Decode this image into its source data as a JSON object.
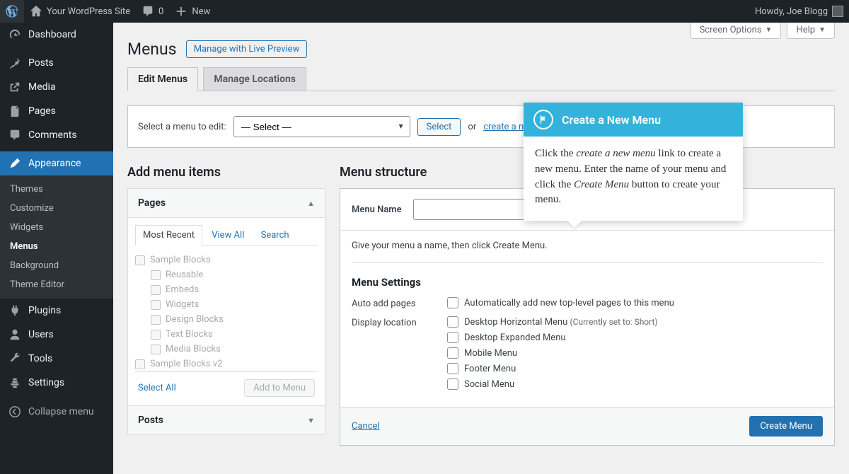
{
  "adminbar": {
    "site_name": "Your WordPress Site",
    "comments_count": "0",
    "new_label": "New",
    "greeting": "Howdy, Joe Blogg"
  },
  "sidebar": {
    "items": [
      {
        "id": "dashboard",
        "label": "Dashboard"
      },
      {
        "id": "posts",
        "label": "Posts"
      },
      {
        "id": "media",
        "label": "Media"
      },
      {
        "id": "pages",
        "label": "Pages"
      },
      {
        "id": "comments",
        "label": "Comments"
      },
      {
        "id": "appearance",
        "label": "Appearance"
      },
      {
        "id": "plugins",
        "label": "Plugins"
      },
      {
        "id": "users",
        "label": "Users"
      },
      {
        "id": "tools",
        "label": "Tools"
      },
      {
        "id": "settings",
        "label": "Settings"
      }
    ],
    "appearance_sub": [
      {
        "label": "Themes"
      },
      {
        "label": "Customize"
      },
      {
        "label": "Widgets"
      },
      {
        "label": "Menus"
      },
      {
        "label": "Background"
      },
      {
        "label": "Theme Editor"
      }
    ],
    "collapse": "Collapse menu"
  },
  "screenmeta": {
    "options": "Screen Options",
    "help": "Help"
  },
  "page": {
    "title": "Menus",
    "title_action": "Manage with Live Preview",
    "tabs": {
      "edit": "Edit Menus",
      "locations": "Manage Locations"
    },
    "select_label": "Select a menu to edit:",
    "select_value": "— Select —",
    "select_button": "Select",
    "or_text": "or",
    "create_link_partial": "create a n"
  },
  "left": {
    "heading": "Add menu items",
    "acc_pages": "Pages",
    "mini_tabs": {
      "recent": "Most Recent",
      "view_all": "View All",
      "search": "Search"
    },
    "pages": [
      "Sample Blocks",
      "Reusable",
      "Embeds",
      "Widgets",
      "Design Blocks",
      "Text Blocks",
      "Media Blocks",
      "Sample Blocks v2"
    ],
    "select_all": "Select All",
    "add_btn": "Add to Menu",
    "acc_posts": "Posts"
  },
  "right": {
    "heading": "Menu structure",
    "menu_name_label": "Menu Name",
    "menu_name_value": "",
    "msg": "Give your menu a name, then click Create Menu.",
    "settings_heading": "Menu Settings",
    "auto_add_label": "Auto add pages",
    "auto_add_opt": "Automatically add new top-level pages to this menu",
    "display_label": "Display location",
    "locations": [
      {
        "label": "Desktop Horizontal Menu",
        "note": "(Currently set to: Short)"
      },
      {
        "label": "Desktop Expanded Menu",
        "note": ""
      },
      {
        "label": "Mobile Menu",
        "note": ""
      },
      {
        "label": "Footer Menu",
        "note": ""
      },
      {
        "label": "Social Menu",
        "note": ""
      }
    ],
    "cancel": "Cancel",
    "create": "Create Menu"
  },
  "popup": {
    "title": "Create a New Menu",
    "body_1": "Click the ",
    "body_em1": "create a new menu",
    "body_2": " link to create a new menu. Enter the name of your menu and click the ",
    "body_em2": "Create Menu",
    "body_3": " button to create your menu."
  }
}
